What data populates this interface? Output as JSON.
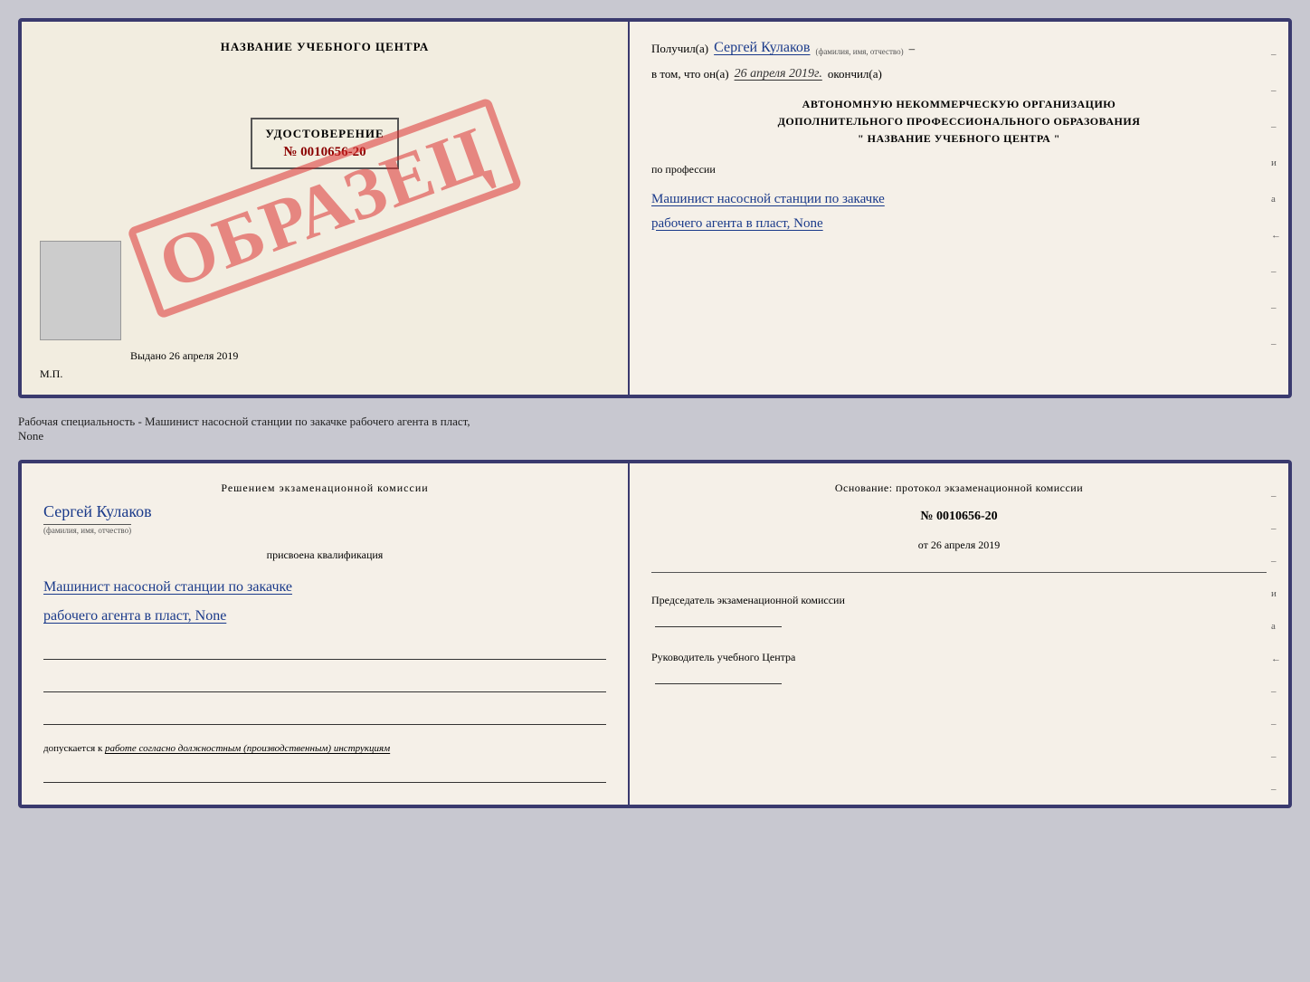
{
  "top_left": {
    "center_title": "НАЗВАНИЕ УЧЕБНОГО ЦЕНТРА",
    "stamp_text": "ОБРАЗЕЦ",
    "cert_title": "УДОСТОВЕРЕНИЕ",
    "cert_number": "№ 0010656-20",
    "issued_label": "Выдано",
    "issued_date": "26 апреля 2019",
    "mp_label": "М.П."
  },
  "top_right": {
    "recipient_label": "Получил(а)",
    "recipient_name": "Сергей Кулаков",
    "recipient_hint": "(фамилия, имя, отчество)",
    "date_label": "в том, что он(а)",
    "date_value": "26 апреля 2019г.",
    "finished_label": "окончил(а)",
    "org_line1": "АВТОНОМНУЮ НЕКОММЕРЧЕСКУЮ ОРГАНИЗАЦИЮ",
    "org_line2": "ДОПОЛНИТЕЛЬНОГО ПРОФЕССИОНАЛЬНОГО ОБРАЗОВАНИЯ",
    "org_line3": "\" НАЗВАНИЕ УЧЕБНОГО ЦЕНТРА \"",
    "profession_label": "по профессии",
    "profession_line1": "Машинист насосной станции по закачке",
    "profession_line2": "рабочего агента в пласт, None",
    "dashes": [
      "-",
      "-",
      "-",
      "и",
      "а",
      "←",
      "-",
      "-",
      "-"
    ]
  },
  "middle_text": "Рабочая специальность - Машинист насосной станции по закачке рабочего агента в пласт,\nNone",
  "bottom_left": {
    "commission_title": "Решением экзаменационной комиссии",
    "name": "Сергей Кулаков",
    "name_hint": "(фамилия, имя, отчество)",
    "kvali_text": "присвоена квалификация",
    "profession_line1": "Машинист насосной станции по закачке",
    "profession_line2": "рабочего агента в пласт, None",
    "допускается_label": "допускается к",
    "допускается_text": "работе согласно должностным (производственным) инструкциям"
  },
  "bottom_right": {
    "osnov_label": "Основание: протокол экзаменационной комиссии",
    "protocol_number": "№ 0010656-20",
    "protocol_date_prefix": "от",
    "protocol_date": "26 апреля 2019",
    "chairman_label": "Председатель экзаменационной комиссии",
    "director_label": "Руководитель учебного Центра",
    "dashes": [
      "-",
      "-",
      "-",
      "и",
      "а",
      "←",
      "-",
      "-",
      "-",
      "-"
    ]
  }
}
